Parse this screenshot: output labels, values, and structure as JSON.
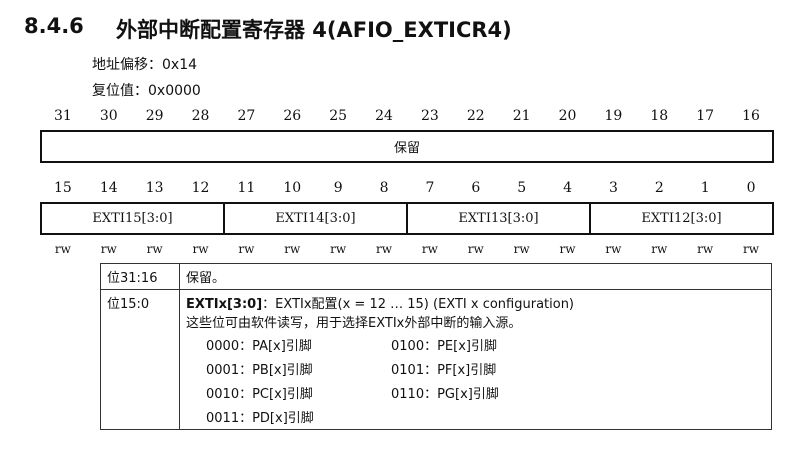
{
  "section": {
    "number": "8.4.6",
    "title": "外部中断配置寄存器 4(AFIO_EXTICR4)"
  },
  "address_offset": "地址偏移：0x14",
  "reset_value": "复位值：0x0000",
  "upper": {
    "bits": [
      "31",
      "30",
      "29",
      "28",
      "27",
      "26",
      "25",
      "24",
      "23",
      "22",
      "21",
      "20",
      "19",
      "18",
      "17",
      "16"
    ],
    "fields": [
      {
        "label": "保留",
        "span": 16
      }
    ]
  },
  "lower": {
    "bits": [
      "15",
      "14",
      "13",
      "12",
      "11",
      "10",
      "9",
      "8",
      "7",
      "6",
      "5",
      "4",
      "3",
      "2",
      "1",
      "0"
    ],
    "fields": [
      {
        "label": "EXTI15[3:0]",
        "span": 4
      },
      {
        "label": "EXTI14[3:0]",
        "span": 4
      },
      {
        "label": "EXTI13[3:0]",
        "span": 4
      },
      {
        "label": "EXTI12[3:0]",
        "span": 4
      }
    ],
    "access": [
      "rw",
      "rw",
      "rw",
      "rw",
      "rw",
      "rw",
      "rw",
      "rw",
      "rw",
      "rw",
      "rw",
      "rw",
      "rw",
      "rw",
      "rw",
      "rw"
    ]
  },
  "description": {
    "rows": [
      {
        "bits": "位31:16",
        "text": "保留。"
      },
      {
        "bits": "位15:0",
        "field_name": "EXTIx[3:0]",
        "field_title": "：EXTIx配置(x = 12 … 15) (EXTI x configuration)",
        "text": "这些位可由软件读写，用于选择EXTIx外部中断的输入源。",
        "codes": [
          "0000：PA[x]引脚",
          "0100：PE[x]引脚",
          "0001：PB[x]引脚",
          "0101：PF[x]引脚",
          "0010：PC[x]引脚",
          "0110：PG[x]引脚",
          "0011：PD[x]引脚"
        ]
      }
    ]
  }
}
